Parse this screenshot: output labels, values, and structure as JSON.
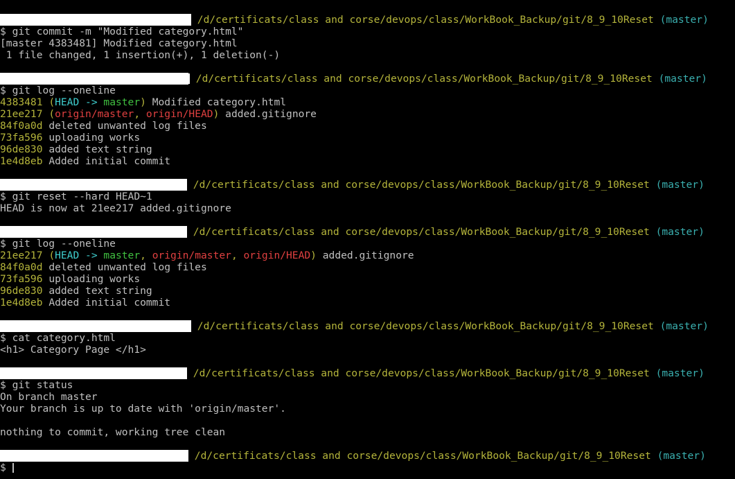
{
  "prompt": {
    "path": "/d/certificats/class and corse/devops/class/WorkBook_Backup/git/8_9_10Reset",
    "branch": "(master)",
    "symbol": "$"
  },
  "blocks": [
    {
      "command": "git commit -m \"Modified category.html\"",
      "output": [
        "[master 4383481] Modified category.html",
        " 1 file changed, 1 insertion(+), 1 deletion(-)"
      ]
    },
    {
      "command": "git log --oneline",
      "log": [
        {
          "hash": "4383481",
          "head": "HEAD -> ",
          "local": "master",
          "remote1": "",
          "remote2": "",
          "msg": "Modified category.html"
        },
        {
          "hash": "21ee217",
          "head": "",
          "local": "",
          "remote1": "origin/master",
          "remote2": "origin/HEAD",
          "msg": "added.gitignore"
        },
        {
          "hash": "84f0a0d",
          "msg": "deleted unwanted log files"
        },
        {
          "hash": "73fa596",
          "msg": "uploading works"
        },
        {
          "hash": "96de830",
          "msg": "added text string"
        },
        {
          "hash": "1e4d8eb",
          "msg": "Added initial commit"
        }
      ]
    },
    {
      "command": "git reset --hard HEAD~1",
      "output": [
        "HEAD is now at 21ee217 added.gitignore"
      ]
    },
    {
      "command": "git log --oneline",
      "log": [
        {
          "hash": "21ee217",
          "head": "HEAD -> ",
          "local": "master",
          "remote1": "origin/master",
          "remote2": "origin/HEAD",
          "msg": "added.gitignore"
        },
        {
          "hash": "84f0a0d",
          "msg": "deleted unwanted log files"
        },
        {
          "hash": "73fa596",
          "msg": "uploading works"
        },
        {
          "hash": "96de830",
          "msg": "added text string"
        },
        {
          "hash": "1e4d8eb",
          "msg": "Added initial commit"
        }
      ]
    },
    {
      "command": "cat category.html",
      "output": [
        "<h1> Category Page </h1>"
      ]
    },
    {
      "command": "git status",
      "output": [
        "On branch master",
        "Your branch is up to date with 'origin/master'.",
        "",
        "nothing to commit, working tree clean"
      ]
    }
  ],
  "colors": {
    "background": "#000000",
    "text": "#c0c0c0",
    "path": "#b5b53b",
    "branch": "#3ab0b0",
    "hash": "#b5b53b",
    "head": "#3fcfcf",
    "local_branch": "#40c040",
    "remote_branch": "#e04040",
    "redaction": "#ffffff"
  }
}
